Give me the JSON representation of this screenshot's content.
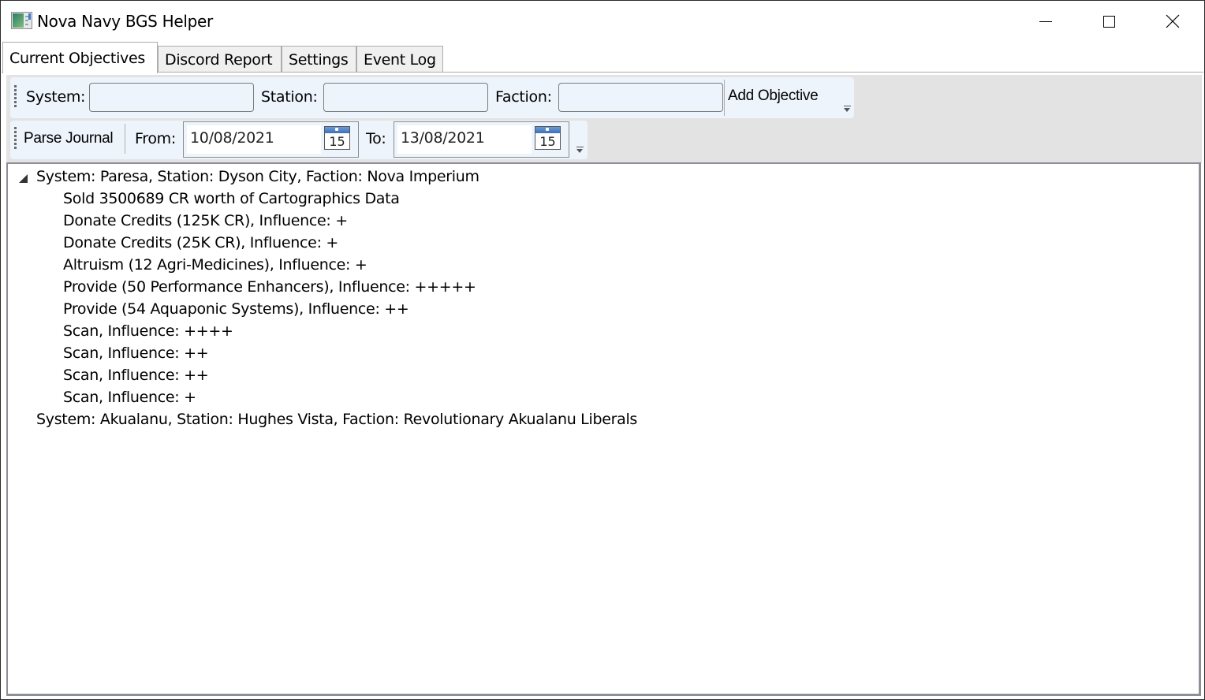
{
  "window": {
    "title": "Nova Navy BGS Helper",
    "app_icon": "app-icon",
    "controls": {
      "minimize": "minimize-icon",
      "maximize": "maximize-icon",
      "close": "close-icon"
    }
  },
  "tabs": [
    {
      "label": "Current Objectives",
      "active": true
    },
    {
      "label": "Discord Report",
      "active": false
    },
    {
      "label": "Settings",
      "active": false
    },
    {
      "label": "Event Log",
      "active": false
    }
  ],
  "objective_toolbar": {
    "system_label": "System:",
    "system_value": "",
    "station_label": "Station:",
    "station_value": "",
    "faction_label": "Faction:",
    "faction_value": "",
    "add_button": "Add Objective"
  },
  "journal_toolbar": {
    "parse_button": "Parse Journal",
    "from_label": "From:",
    "from_value": "10/08/2021",
    "to_label": "To:",
    "to_value": "13/08/2021",
    "calendar_day": "15"
  },
  "tree": {
    "nodes": [
      {
        "label": "System: Paresa, Station: Dyson City, Faction: Nova Imperium",
        "expanded": true,
        "children": [
          "Sold 3500689 CR worth of Cartographics Data",
          "Donate Credits (125K CR), Influence: +",
          "Donate Credits (25K CR), Influence: +",
          "Altruism (12 Agri-Medicines), Influence: +",
          "Provide (50 Performance Enhancers), Influence: +++++",
          "Provide (54 Aquaponic Systems), Influence: ++",
          "Scan, Influence: ++++",
          "Scan, Influence: ++",
          "Scan, Influence: ++",
          "Scan, Influence: +"
        ]
      },
      {
        "label": "System: Akualanu, Station: Hughes Vista, Faction: Revolutionary Akualanu Liberals",
        "expanded": false,
        "children": []
      }
    ]
  }
}
